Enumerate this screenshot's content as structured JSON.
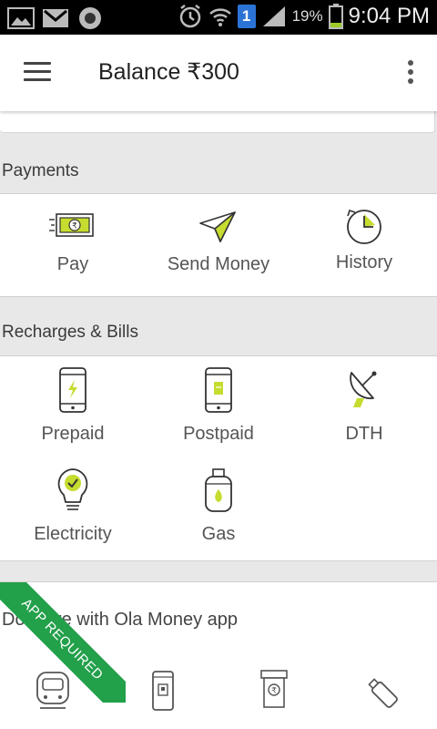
{
  "status_bar": {
    "battery_percent": "19%",
    "time": "9:04 PM",
    "notification_count": "1",
    "left_icons": [
      "gallery-icon",
      "gmail-icon",
      "circle-app-icon"
    ],
    "right_icons": [
      "alarm-icon",
      "wifi-icon",
      "notification-badge-icon",
      "signal-icon",
      "battery-icon"
    ]
  },
  "app_bar": {
    "title": "Balance ₹300",
    "menu_icon": "hamburger-menu-icon",
    "more_icon": "overflow-menu-icon"
  },
  "payments": {
    "header": "Payments",
    "items": [
      {
        "label": "Pay",
        "icon": "cash-icon"
      },
      {
        "label": "Send Money",
        "icon": "paper-plane-icon"
      },
      {
        "label": "History",
        "icon": "history-clock-icon"
      }
    ]
  },
  "recharges": {
    "header": "Recharges & Bills",
    "items": [
      {
        "label": "Prepaid",
        "icon": "phone-bolt-icon"
      },
      {
        "label": "Postpaid",
        "icon": "phone-bill-icon"
      },
      {
        "label": "DTH",
        "icon": "satellite-dish-icon"
      },
      {
        "label": "Electricity",
        "icon": "lightbulb-icon"
      },
      {
        "label": "Gas",
        "icon": "gas-cylinder-icon"
      }
    ]
  },
  "promo": {
    "text": "Do more with Ola Money app",
    "ribbon": "APP REQUIRED",
    "icons": [
      "metro-train-icon",
      "phone-qr-icon",
      "bill-counter-icon",
      "usb-stick-icon"
    ]
  },
  "colors": {
    "accent": "#c6dc2f",
    "ribbon": "#22a04a"
  }
}
